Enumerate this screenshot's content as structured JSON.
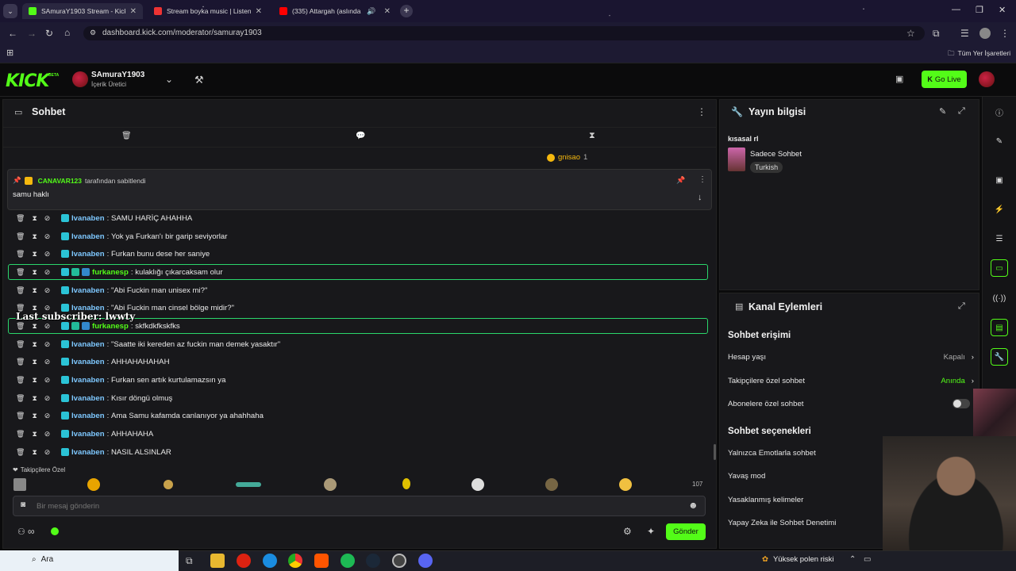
{
  "browser": {
    "tabs": [
      {
        "title": "SAmuraY1903 Stream - Kick Dashboard",
        "color": "#53fc18"
      },
      {
        "title": "Stream boyka music | Listen to",
        "color": "#e33"
      },
      {
        "title": "(335) Attargah (aslında Attarg",
        "color": "#f00"
      }
    ],
    "url": "dashboard.kick.com/moderator/samuray1903",
    "bookmarks_label": "Tüm Yer İşaretleri"
  },
  "header": {
    "logo": "KICK",
    "logo_tag": "BETA",
    "channel_name": "SAmuraY1903",
    "channel_role": "İçerik Üretici",
    "go_live_label": "Go Live"
  },
  "chat": {
    "title": "Sohbet",
    "user_highlight": "gnisao",
    "user_highlight_count": "1",
    "pinned": {
      "pinned_by": "CANAVAR123",
      "pinned_suffix": "tarafından sabitlendi",
      "message": "samu haklı"
    },
    "overlay_text": "Last subscriber: lwwty",
    "messages": [
      {
        "user": "Ivanaben",
        "text": "SAMU HARİÇ AHAHHA",
        "highlight": false
      },
      {
        "user": "Ivanaben",
        "text": "Yok ya Furkan'ı bir garip seviyorlar",
        "highlight": false
      },
      {
        "user": "Ivanaben",
        "text": "Furkan bunu dese her saniye",
        "highlight": false
      },
      {
        "user": "furkanesp",
        "text": "kulaklığı çıkarcaksam olur",
        "highlight": true
      },
      {
        "user": "Ivanaben",
        "text": "\"Abi Fuckin man unisex mi?\"",
        "highlight": false
      },
      {
        "user": "Ivanaben",
        "text": "\"Abi Fuckin man cinsel bölge midir?\"",
        "highlight": false
      },
      {
        "user": "furkanesp",
        "text": "skfkdkfkskfks",
        "highlight": true
      },
      {
        "user": "Ivanaben",
        "text": "\"Saatte iki kereden az fuckin man demek yasaktır\"",
        "highlight": false
      },
      {
        "user": "Ivanaben",
        "text": "AHHAHAHAHAH",
        "highlight": false
      },
      {
        "user": "Ivanaben",
        "text": "Furkan sen artık kurtulamazsın ya",
        "highlight": false
      },
      {
        "user": "Ivanaben",
        "text": "Kısır döngü olmuş",
        "highlight": false
      },
      {
        "user": "Ivanaben",
        "text": "Ama Samu kafamda canlanıyor ya ahahhaha",
        "highlight": false
      },
      {
        "user": "Ivanaben",
        "text": "AHHAHAHA",
        "highlight": false
      },
      {
        "user": "Ivanaben",
        "text": "NASIL ALSINLAR",
        "highlight": false
      }
    ],
    "followers_only_label": "Takipçilere Özel",
    "emote_count": "107",
    "input_placeholder": "Bir mesaj gönderin",
    "send_label": "Gönder"
  },
  "stream_info": {
    "title": "Yayın bilgisi",
    "stream_title": "kısasal rl",
    "category": "Sadece Sohbet",
    "language": "Turkish"
  },
  "channel_actions": {
    "title": "Kanal Eylemleri",
    "chat_access": "Sohbet erişimi",
    "rows": [
      {
        "label": "Hesap yaşı",
        "value": "Kapalı"
      },
      {
        "label": "Takipçilere özel sohbet",
        "value": "Anında"
      },
      {
        "label": "Abonelere özel sohbet",
        "value": ""
      }
    ],
    "chat_options": "Sohbet seçenekleri",
    "options": [
      "Yalnızca Emotlarla sohbet",
      "Yavaş mod",
      "Yasaklanmış kelimeler",
      "Yapay Zeka ile Sohbet Denetimi"
    ]
  },
  "taskbar": {
    "search_label": "Ara",
    "weather_label": "Yüksek polen riski"
  }
}
